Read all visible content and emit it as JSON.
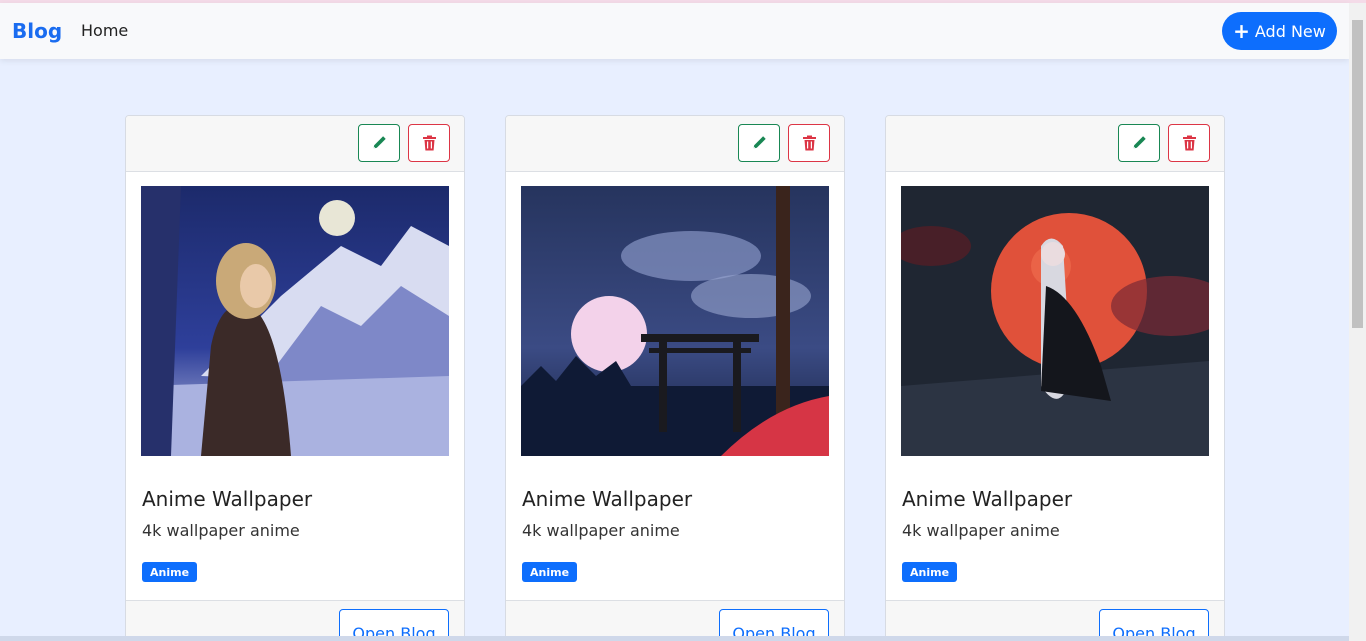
{
  "navbar": {
    "brand": "Blog",
    "home_link": "Home",
    "add_button": "Add New"
  },
  "cards": [
    {
      "title": "Anime Wallpaper",
      "description": "4k wallpaper anime",
      "badge": "Anime",
      "open_button": "Open Blog"
    },
    {
      "title": "Anime Wallpaper",
      "description": "4k wallpaper anime",
      "badge": "Anime",
      "open_button": "Open Blog"
    },
    {
      "title": "Anime Wallpaper",
      "description": "4k wallpaper anime",
      "badge": "Anime",
      "open_button": "Open Blog"
    }
  ],
  "icons": {
    "edit": "pencil-icon",
    "delete": "trash-icon",
    "add": "plus-icon"
  },
  "colors": {
    "primary": "#0d6efd",
    "edit": "#198754",
    "delete": "#dc3545",
    "background": "#e8efff"
  }
}
